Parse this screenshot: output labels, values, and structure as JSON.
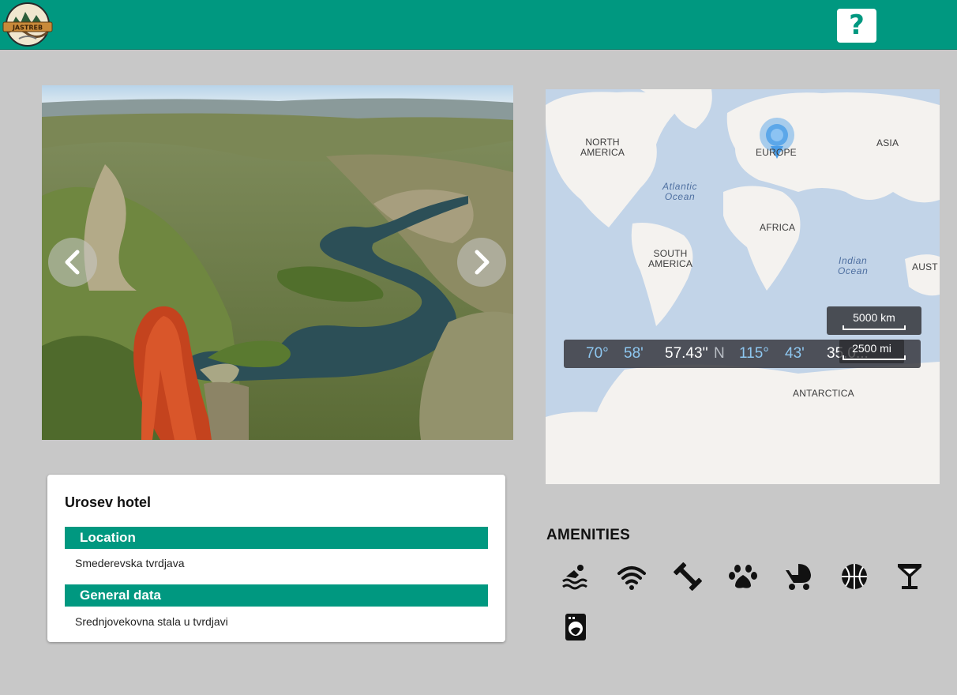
{
  "header": {
    "logo_text": "JASTREB",
    "help_label": "?"
  },
  "carousel": {
    "prev_label": "previous-image",
    "next_label": "next-image"
  },
  "hotel": {
    "name": "Urosev hotel",
    "location_heading": "Location",
    "location_value": "Smederevska tvrdjava",
    "general_heading": "General data",
    "general_value": "Srednjovekovna stala u tvrdjavi"
  },
  "map": {
    "labels": {
      "north_america": "NORTH\nAMERICA",
      "south_america": "SOUTH\nAMERICA",
      "europe": "EUROPE",
      "asia": "ASIA",
      "africa": "AFRICA",
      "antarctica": "ANTARCTICA",
      "australia": "AUST",
      "atlantic": "Atlantic\nOcean",
      "indian": "Indian\nOcean"
    },
    "coordinates": {
      "lat_deg": "70°",
      "lat_min": "58'",
      "lat_sec": "57.43''",
      "lat_dir": "N",
      "lon_deg": "115°",
      "lon_min": "43'",
      "lon_sec": "35.0..."
    },
    "scale_km": "5000 km",
    "scale_mi": "2500 mi",
    "colors": {
      "water": "#c2d4e8",
      "land": "#f4f2ef",
      "pin": "#4a9de8"
    }
  },
  "amenities": {
    "title": "AMENITIES",
    "icons": [
      "swimming-icon",
      "wifi-icon",
      "gym-icon",
      "pet-icon",
      "stroller-icon",
      "basketball-icon",
      "cocktail-icon",
      "laundry-icon"
    ]
  },
  "colors": {
    "accent": "#009880",
    "background": "#c8c8c8"
  }
}
